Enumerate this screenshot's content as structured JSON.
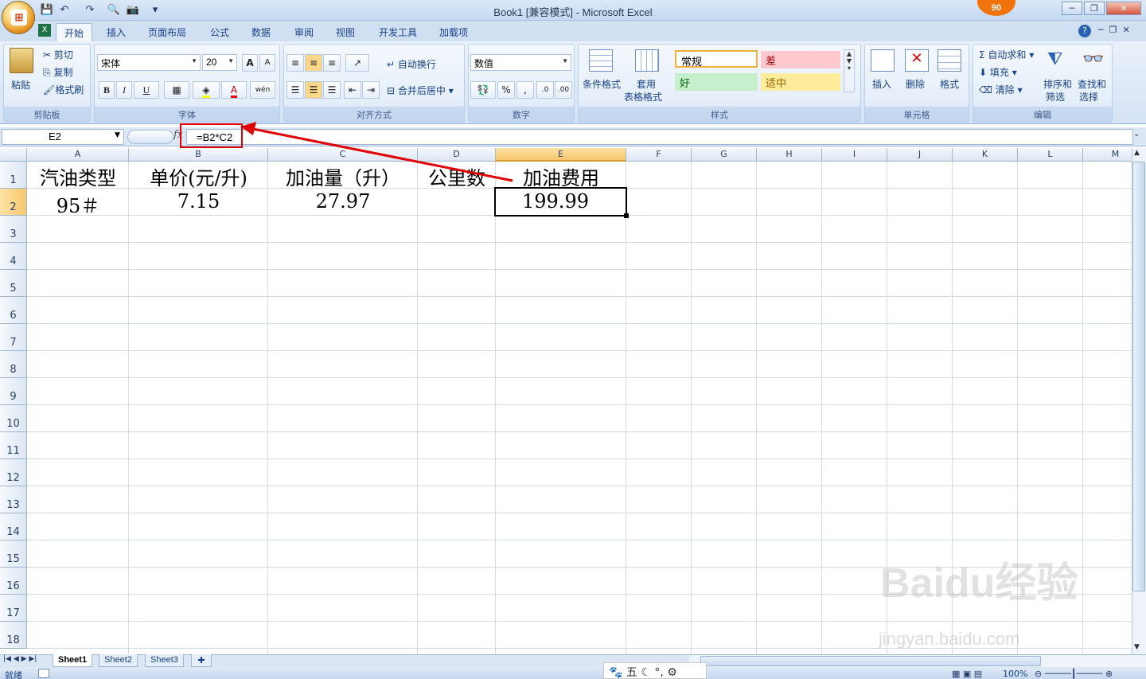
{
  "window": {
    "title": "Book1  [兼容模式] - Microsoft Excel",
    "badge": "90"
  },
  "qat": {
    "save": "💾",
    "undo": "↶",
    "redo": "↷",
    "preview": "🔍",
    "camera": "📷",
    "more": "▾"
  },
  "tabs": [
    "开始",
    "插入",
    "页面布局",
    "公式",
    "数据",
    "审阅",
    "视图",
    "开发工具",
    "加载项"
  ],
  "ribbon": {
    "clipboard": {
      "label": "剪贴板",
      "paste": "粘贴",
      "cut": "剪切",
      "copy": "复制",
      "format_painter": "格式刷"
    },
    "font": {
      "label": "字体",
      "name": "宋体",
      "size": "20",
      "grow": "A",
      "shrink": "A",
      "bold": "B",
      "italic": "I",
      "underline": "U",
      "wen": "wén"
    },
    "alignment": {
      "label": "对齐方式",
      "wrap": "自动换行",
      "merge": "合并后居中"
    },
    "number": {
      "label": "数字",
      "format": "数值",
      "percent": "%",
      "comma": ","
    },
    "styles": {
      "label": "样式",
      "conditional": "条件格式",
      "table1": "套用",
      "table2": "表格格式",
      "normal": "常规",
      "bad": "差",
      "good": "好",
      "neutral": "适中"
    },
    "cells": {
      "label": "单元格",
      "insert": "插入",
      "delete": "删除",
      "format": "格式"
    },
    "editing": {
      "label": "编辑",
      "autosum": "自动求和",
      "fill": "填充",
      "clear": "清除",
      "sort1": "排序和",
      "sort2": "筛选",
      "find1": "查找和",
      "find2": "选择"
    }
  },
  "formula_bar": {
    "name_box": "E2",
    "fx": "fx",
    "formula": "=B2*C2"
  },
  "columns": [
    "A",
    "B",
    "C",
    "D",
    "E",
    "F",
    "G",
    "H",
    "I",
    "J",
    "K",
    "L",
    "M"
  ],
  "rows": [
    "1",
    "2",
    "3",
    "4",
    "5",
    "6",
    "7",
    "8",
    "9",
    "10",
    "11",
    "12",
    "13",
    "14",
    "15",
    "16",
    "17",
    "18"
  ],
  "cells": {
    "A1": "汽油类型",
    "B1": "单价(元/升)",
    "C1": "加油量（升）",
    "D1": "公里数",
    "E1": "加油费用",
    "A2": "95＃",
    "B2": "7.15",
    "C2": "27.97",
    "E2": "199.99"
  },
  "sheets": [
    "Sheet1",
    "Sheet2",
    "Sheet3"
  ],
  "status": {
    "ready": "就绪",
    "zoom": "100%"
  },
  "ime": {
    "text": "五"
  },
  "watermark": {
    "brand": "Baidu经验",
    "url": "jingyan.baidu.com"
  },
  "colors": {
    "annotation": "#e00000",
    "selected_header": "#f8c76a"
  }
}
